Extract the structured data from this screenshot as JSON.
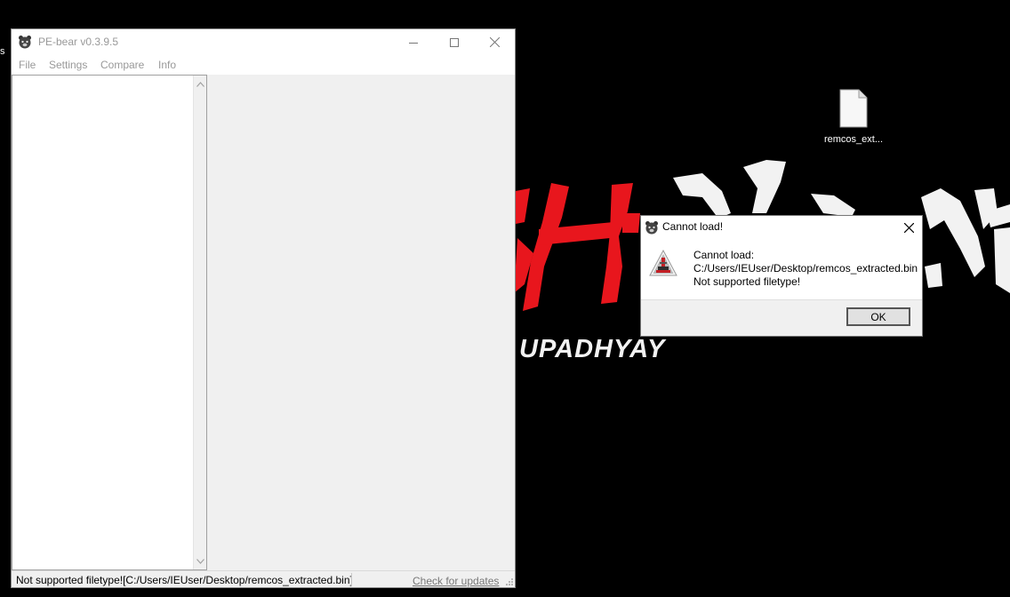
{
  "desktop": {
    "wallpaper_text": "UPADHYAY",
    "file_icon": {
      "label": "remcos_ext...",
      "icon": "file-icon"
    },
    "stray_glyph": "s"
  },
  "app_window": {
    "title": "PE-bear v0.3.9.5",
    "icon": "bear-icon",
    "controls": {
      "minimize": "minimize-icon",
      "maximize": "maximize-icon",
      "close": "close-icon"
    },
    "menu": [
      "File",
      "Settings",
      "Compare",
      "Info"
    ],
    "statusbar": {
      "message": "Not supported filetype![C:/Users/IEUser/Desktop/remcos_extracted.bin]",
      "link": "Check for updates"
    }
  },
  "dialog": {
    "title": "Cannot load!",
    "icon": "warning-icon",
    "lines": [
      "Cannot load:",
      "C:/Users/IEUser/Desktop/remcos_extracted.bin",
      "Not supported filetype!"
    ],
    "ok_label": "OK"
  },
  "colors": {
    "wallpaper_red": "#e8161d",
    "wallpaper_white": "#f2f2f2",
    "desktop_bg": "#000000"
  }
}
